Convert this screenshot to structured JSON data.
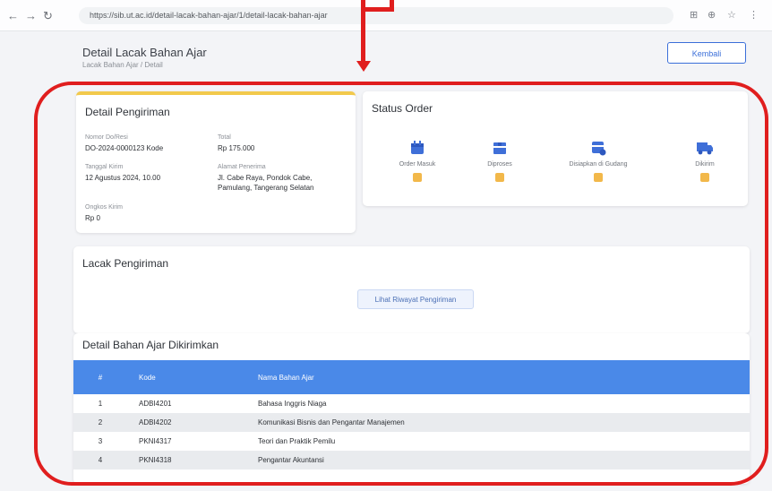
{
  "browser": {
    "url": "https://sib.ut.ac.id/detail-lacak-bahan-ajar/1/detail-lacak-bahan-ajar"
  },
  "page": {
    "title": "Detail Lacak Bahan Ajar",
    "subtitle": "Lacak Bahan Ajar / Detail",
    "back_label": "Kembali"
  },
  "shipping": {
    "title": "Detail Pengiriman",
    "fields": [
      {
        "label": "Nomor Do/Resi",
        "value": "DO-2024-0000123 Kode"
      },
      {
        "label": "Total",
        "value": "Rp 175.000"
      },
      {
        "label": "Tanggal Kirim",
        "value": "12 Agustus 2024, 10.00"
      },
      {
        "label": "Alamat Penerima",
        "value": "Jl. Cabe Raya, Pondok Cabe, Pamulang, Tangerang Selatan"
      },
      {
        "label": "Ongkos Kirim",
        "value": "Rp 0"
      }
    ]
  },
  "status": {
    "title": "Status Order",
    "steps": [
      {
        "label": "Order Masuk",
        "icon": "calendar-icon"
      },
      {
        "label": "Diproses",
        "icon": "box-icon"
      },
      {
        "label": "Disiapkan di Gudang",
        "icon": "package-icon"
      },
      {
        "label": "Dikirim",
        "icon": "truck-icon"
      }
    ]
  },
  "tracking": {
    "title": "Lacak Pengiriman",
    "button_label": "Lihat Riwayat Pengiriman"
  },
  "detail": {
    "title": "Detail Bahan Ajar Dikirimkan",
    "columns": [
      "#",
      "Kode",
      "Nama Bahan Ajar"
    ],
    "rows": [
      {
        "no": "1",
        "kode": "ADBI4201",
        "nama": "Bahasa Inggris Niaga"
      },
      {
        "no": "2",
        "kode": "ADBI4202",
        "nama": "Komunikasi Bisnis dan Pengantar Manajemen"
      },
      {
        "no": "3",
        "kode": "PKNI4317",
        "nama": "Teori dan Praktik Pemilu"
      },
      {
        "no": "4",
        "kode": "PKNI4318",
        "nama": "Pengantar Akuntansi"
      }
    ]
  },
  "colors": {
    "accent": "#4a89e8",
    "annotation": "#e01e1e",
    "card_highlight": "#f2c94c"
  }
}
